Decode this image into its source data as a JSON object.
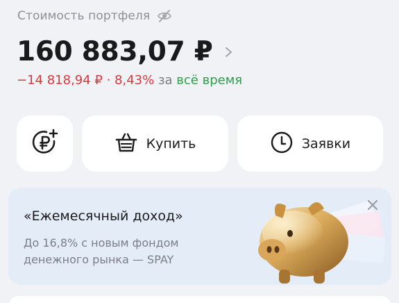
{
  "header": {
    "portfolio_label": "Стоимость портфеля",
    "portfolio_value": "160 883,07 ₽",
    "change_amount": "−14 818,94 ₽",
    "change_separator": " · ",
    "change_percent": "8,43%",
    "period_prefix": " за ",
    "period_value": "всё время"
  },
  "actions": {
    "add_money_icon": "ruble-plus-icon",
    "buy_label": "Купить",
    "buy_icon": "basket-icon",
    "orders_label": "Заявки",
    "orders_icon": "clock-icon"
  },
  "promo": {
    "title": "«Ежемесячный доход»",
    "description": "До 16,8% с новым фондом денежного рынка — SPAY",
    "illustration": "golden-piggy-bank"
  },
  "colors": {
    "background": "#f1f2f6",
    "negative": "#d9383e",
    "positive": "#2e9e4a",
    "muted": "#8e8f96",
    "promo_background": "#e4ecf8"
  }
}
